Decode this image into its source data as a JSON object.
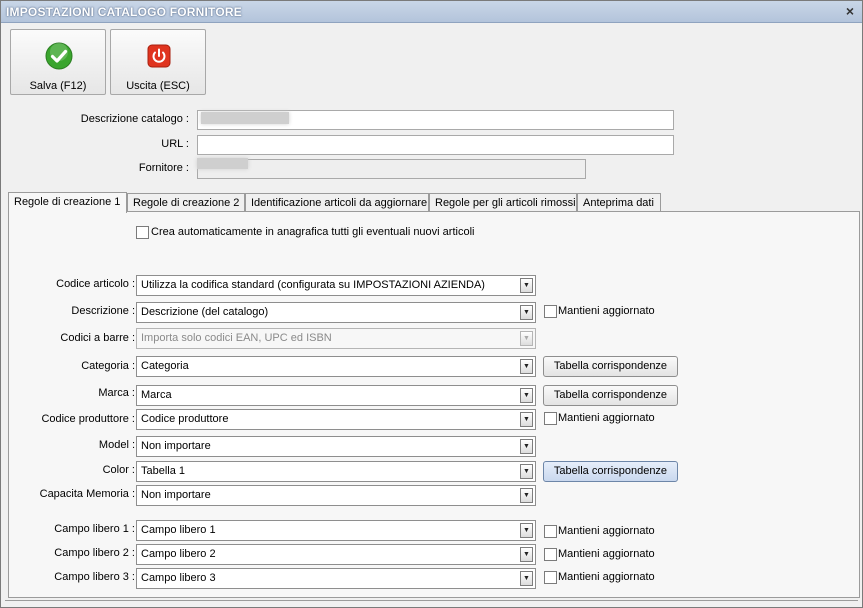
{
  "window": {
    "title": "IMPOSTAZIONI CATALOGO FORNITORE",
    "close_glyph": "×"
  },
  "toolbar": {
    "save_label": "Salva (F12)",
    "exit_label": "Uscita (ESC)",
    "save_icon": "check-circle-icon",
    "exit_icon": "power-icon",
    "save_color": "#3aa52e",
    "exit_color": "#e0341f"
  },
  "form": {
    "descrizione_label": "Descrizione catalogo :",
    "descrizione_value": "",
    "url_label": "URL :",
    "url_value": "",
    "fornitore_label": "Fornitore :",
    "fornitore_value": ""
  },
  "tabs": [
    {
      "label": "Regole di creazione 1",
      "active": true
    },
    {
      "label": "Regole di creazione 2",
      "active": false
    },
    {
      "label": "Identificazione articoli da aggiornare",
      "active": false
    },
    {
      "label": "Regole per gli articoli rimossi",
      "active": false
    },
    {
      "label": "Anteprima dati",
      "active": false
    }
  ],
  "panel": {
    "auto_create_label": "Crea automaticamente in anagrafica tutti gli eventuali nuovi articoli",
    "auto_create_checked": false,
    "keep_updated_label": "Mantieni aggiornato",
    "mapping_button_label": "Tabella corrispondenze",
    "rows": [
      {
        "label": "Codice articolo :",
        "value": "Utilizza la codifica standard (configurata su IMPOSTAZIONI AZIENDA)"
      },
      {
        "label": "Descrizione :",
        "value": "Descrizione (del catalogo)"
      },
      {
        "label": "Codici a barre :",
        "value": "Importa solo codici EAN, UPC ed ISBN",
        "disabled": true
      },
      {
        "label": "Categoria :",
        "value": "Categoria"
      },
      {
        "label": "Marca :",
        "value": "Marca"
      },
      {
        "label": "Codice produttore :",
        "value": "Codice produttore"
      },
      {
        "label": "Model :",
        "value": "Non importare"
      },
      {
        "label": "Color :",
        "value": "Tabella 1"
      },
      {
        "label": "Capacita Memoria :",
        "value": "Non importare"
      },
      {
        "label": "Campo libero 1 :",
        "value": "Campo libero 1"
      },
      {
        "label": "Campo libero 2 :",
        "value": "Campo libero 2"
      },
      {
        "label": "Campo libero 3 :",
        "value": "Campo libero 3"
      }
    ]
  }
}
